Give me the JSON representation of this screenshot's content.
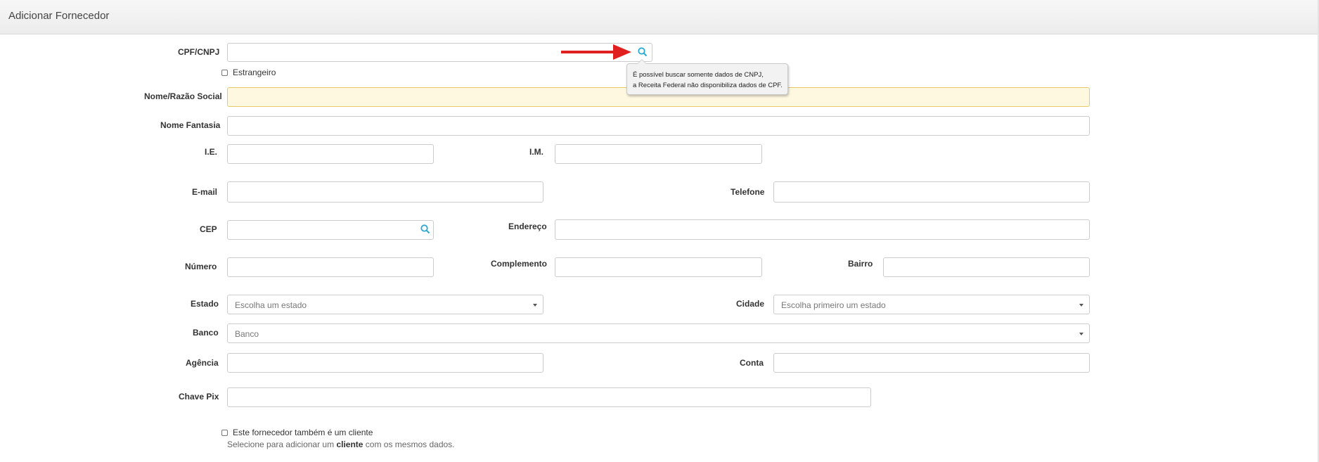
{
  "header": {
    "title": "Adicionar Fornecedor"
  },
  "form": {
    "cpf_cnpj": {
      "label": "CPF/CNPJ",
      "value": ""
    },
    "estrangeiro": {
      "label": "Estrangeiro",
      "checked": false
    },
    "nome_razao": {
      "label": "Nome/Razão Social",
      "value": ""
    },
    "nome_fantasia": {
      "label": "Nome Fantasia",
      "value": ""
    },
    "ie": {
      "label": "I.E.",
      "value": ""
    },
    "im": {
      "label": "I.M.",
      "value": ""
    },
    "email": {
      "label": "E-mail",
      "value": ""
    },
    "telefone": {
      "label": "Telefone",
      "value": ""
    },
    "cep": {
      "label": "CEP",
      "value": ""
    },
    "endereco": {
      "label": "Endereço",
      "value": ""
    },
    "numero": {
      "label": "Número",
      "value": ""
    },
    "complemento": {
      "label": "Complemento",
      "value": ""
    },
    "bairro": {
      "label": "Bairro",
      "value": ""
    },
    "estado": {
      "label": "Estado",
      "placeholder": "Escolha um estado"
    },
    "cidade": {
      "label": "Cidade",
      "placeholder": "Escolha primeiro um estado"
    },
    "banco": {
      "label": "Banco",
      "placeholder": "Banco"
    },
    "agencia": {
      "label": "Agência",
      "value": ""
    },
    "conta": {
      "label": "Conta",
      "value": ""
    },
    "chave_pix": {
      "label": "Chave Pix",
      "value": ""
    },
    "tambem_cliente": {
      "label": "Este fornecedor também é um cliente",
      "checked": false,
      "help_prefix": "Selecione para adicionar um",
      "help_bold": "cliente",
      "help_suffix": "com os mesmos dados."
    }
  },
  "tooltip": {
    "line1": "É possível buscar somente dados de CNPJ,",
    "line2": "a Receita Federal não disponibiliza dados de CPF."
  },
  "colors": {
    "accent_icon": "#29a8d6",
    "arrow": "#e02020",
    "warning_bg": "#fff8e0"
  },
  "icons": {
    "search": "search-icon",
    "arrow": "red-arrow-annotation"
  }
}
